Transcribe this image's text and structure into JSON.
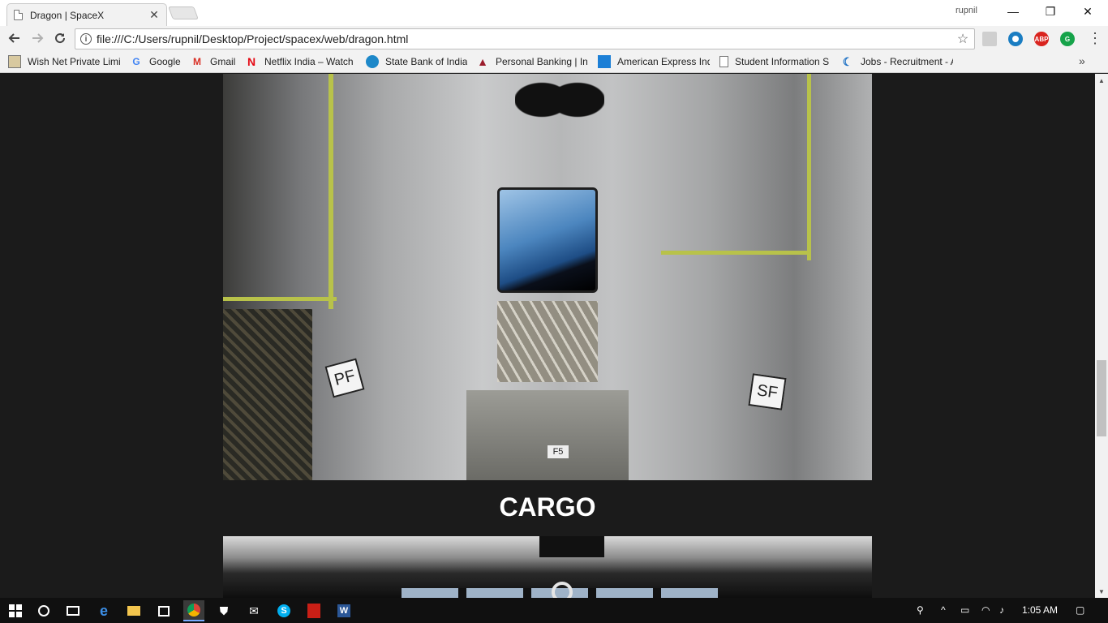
{
  "browser": {
    "tab_title": "Dragon | SpaceX",
    "tab_close": "✕",
    "profile_name": "rupnil",
    "window_controls": {
      "minimize": "—",
      "restore": "❐",
      "close": "✕"
    },
    "url": "file:///C:/Users/rupnil/Desktop/Project/spacex/web/dragon.html",
    "info_icon": "i",
    "star_icon": "☆",
    "extensions": [
      {
        "name": "extension-icon",
        "color": "#cfcfcf",
        "label": ""
      },
      {
        "name": "eye-extension-icon",
        "color": "#1a7dc2",
        "label": ""
      },
      {
        "name": "adblock-plus-icon",
        "color": "#d9241f",
        "label": "ABP"
      },
      {
        "name": "grammarly-icon",
        "color": "#16a34a",
        "label": "G"
      }
    ],
    "menu_icon": "⋮"
  },
  "bookmarks": {
    "items": [
      {
        "icon": "wishnet-icon",
        "label": "Wish Net Private Limi"
      },
      {
        "icon": "google-icon",
        "label": "Google"
      },
      {
        "icon": "gmail-icon",
        "label": "Gmail"
      },
      {
        "icon": "netflix-icon",
        "label": "Netflix India – Watch"
      },
      {
        "icon": "sbi-icon",
        "label": "State Bank of India"
      },
      {
        "icon": "personal-banking-icon",
        "label": "Personal Banking | Int"
      },
      {
        "icon": "amex-icon",
        "label": "American Express Ind"
      },
      {
        "icon": "document-icon",
        "label": "Student Information S"
      },
      {
        "icon": "jobs-icon",
        "label": "Jobs - Recruitment - A"
      }
    ],
    "more": "»"
  },
  "page": {
    "section_title": "CARGO",
    "cargo_labels": {
      "pf": "PF",
      "sf": "SF",
      "f5": "F5"
    }
  },
  "taskbar": {
    "time": "1:05 AM"
  }
}
